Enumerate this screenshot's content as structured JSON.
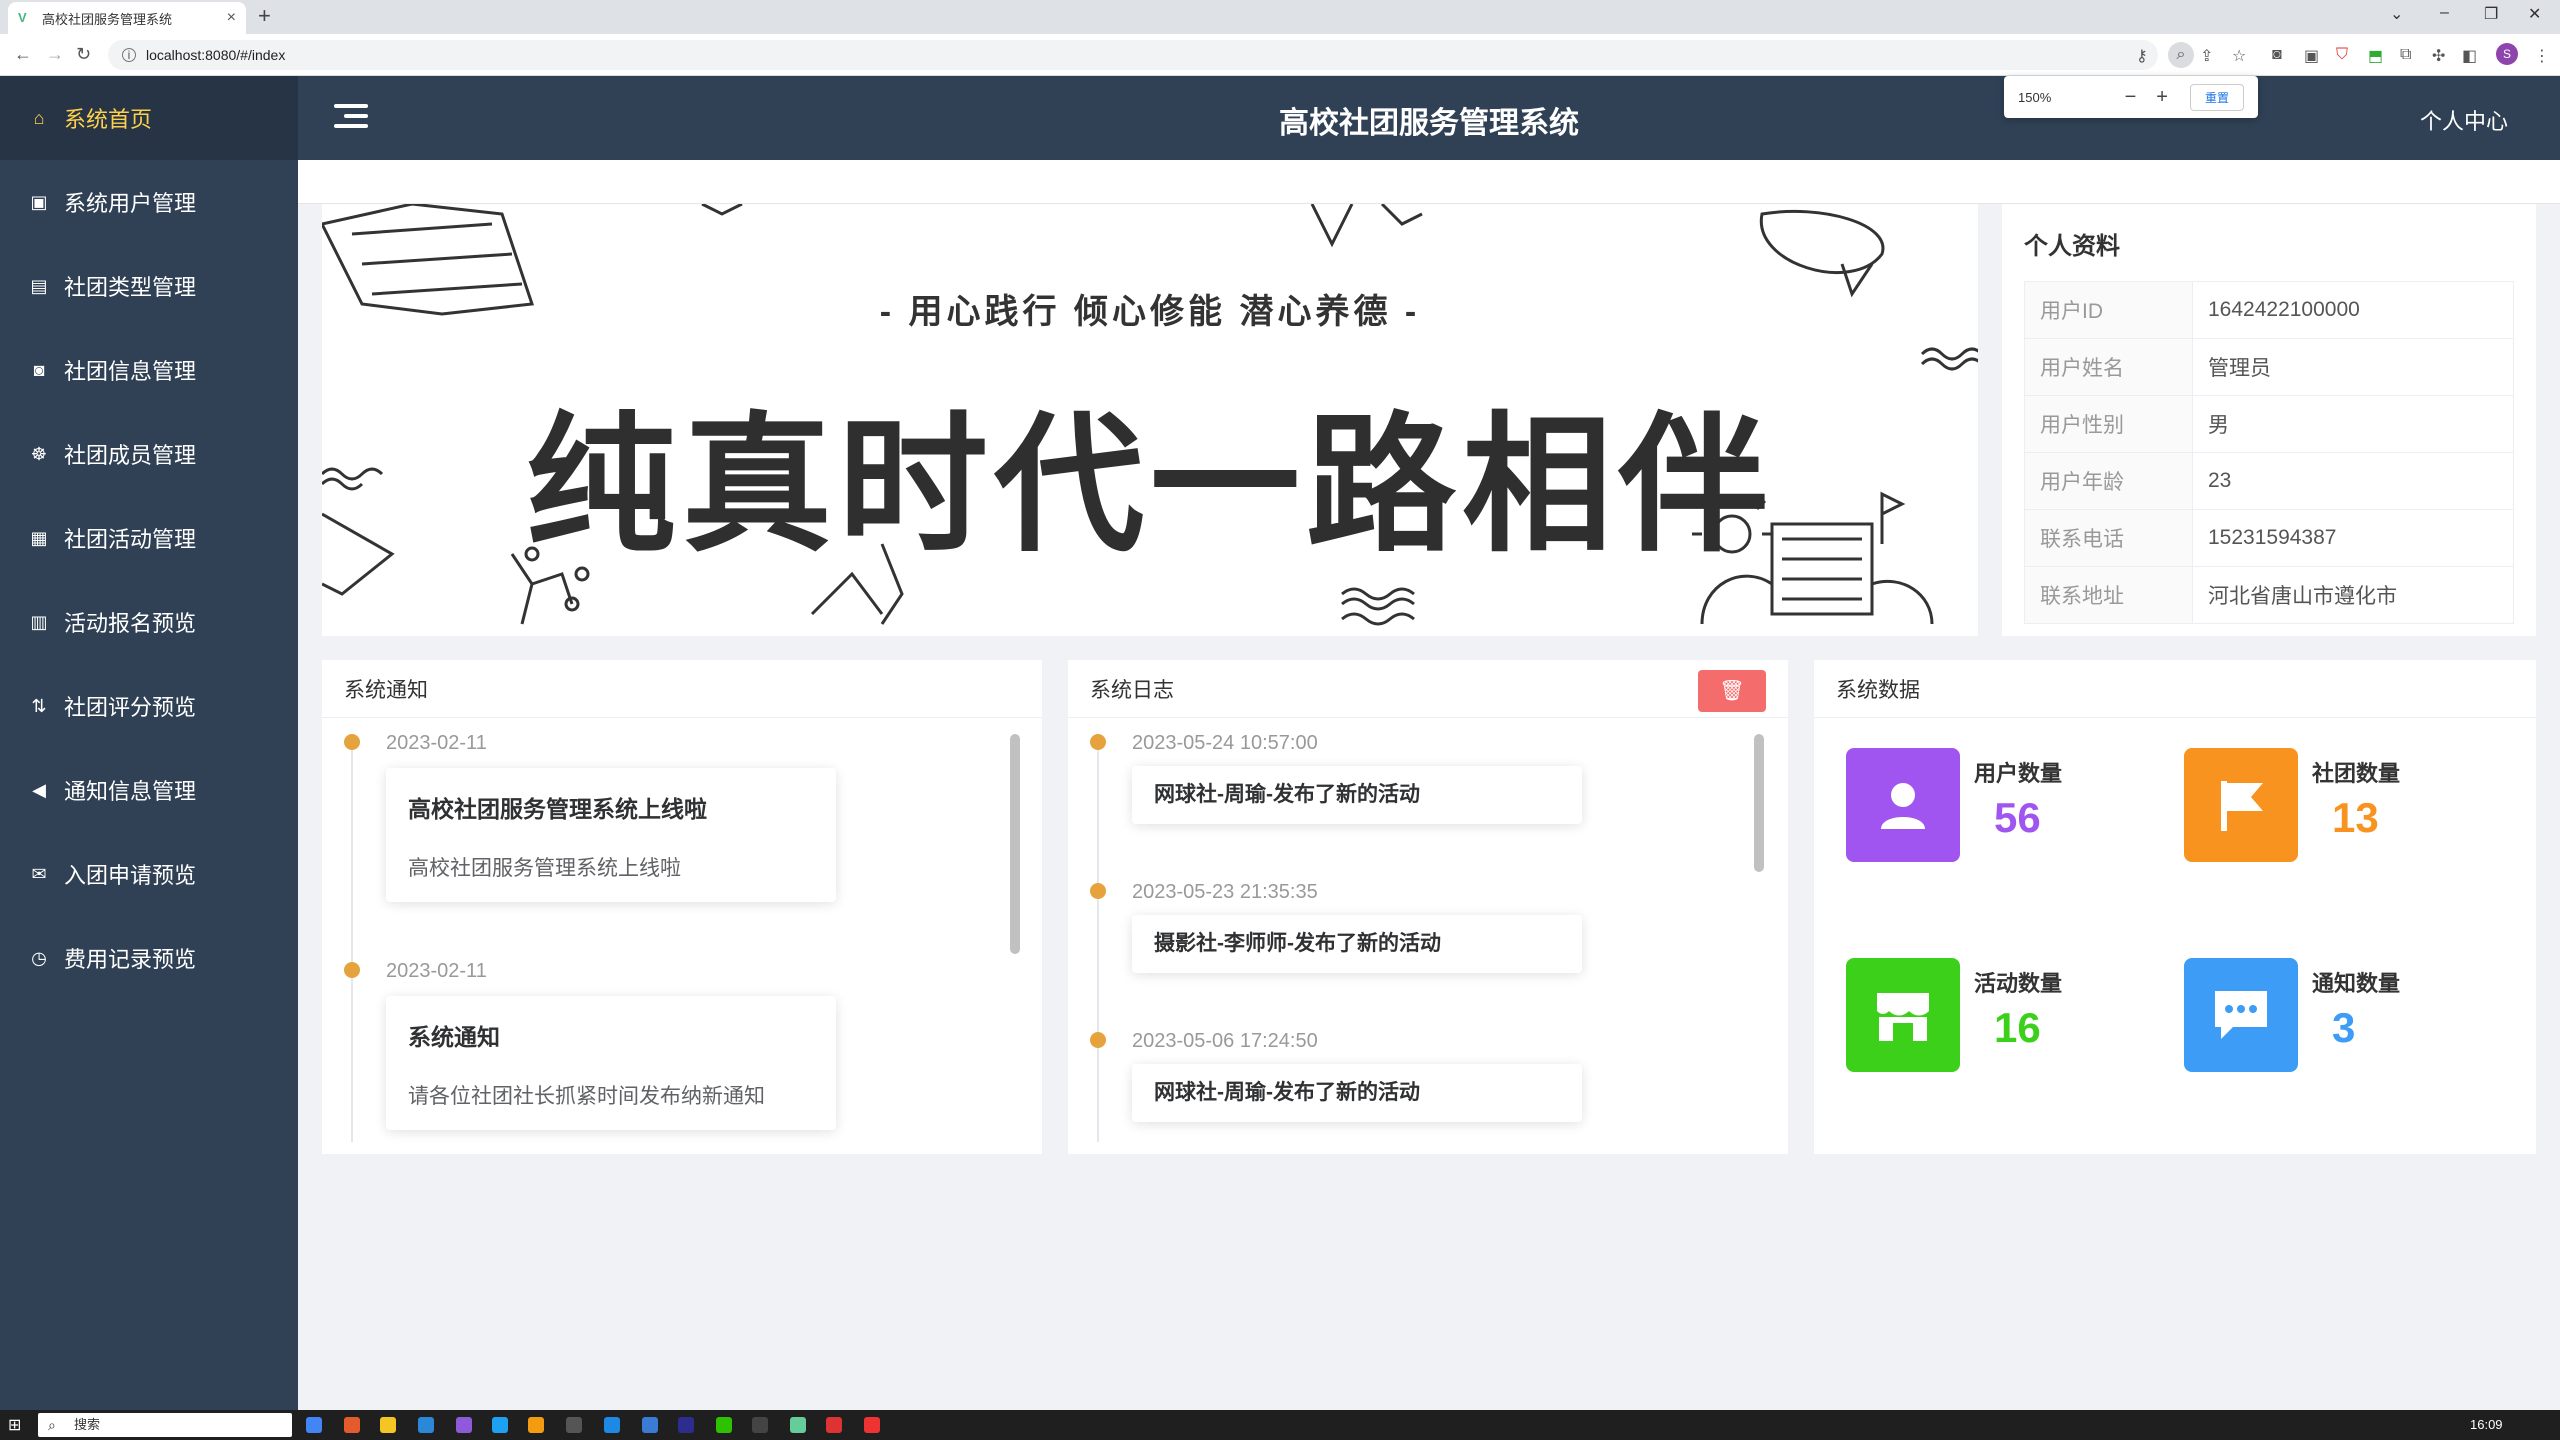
{
  "browser": {
    "tab_title": "高校社团服务管理系统",
    "url": "localhost:8080/#/index",
    "zoom_value": "150%",
    "zoom_reset": "重置",
    "profile_initial": "S"
  },
  "sidebar": {
    "items": [
      {
        "label": "系统首页",
        "icon": "home-icon",
        "active": true
      },
      {
        "label": "系统用户管理",
        "icon": "user-card-icon"
      },
      {
        "label": "社团类型管理",
        "icon": "document-icon"
      },
      {
        "label": "社团信息管理",
        "icon": "bus-icon"
      },
      {
        "label": "社团成员管理",
        "icon": "group-icon"
      },
      {
        "label": "社团活动管理",
        "icon": "calendar-grid-icon"
      },
      {
        "label": "活动报名预览",
        "icon": "calendar-icon"
      },
      {
        "label": "社团评分预览",
        "icon": "sort-icon"
      },
      {
        "label": "通知信息管理",
        "icon": "megaphone-icon"
      },
      {
        "label": "入团申请预览",
        "icon": "mail-open-icon"
      },
      {
        "label": "费用记录预览",
        "icon": "clock-icon"
      }
    ]
  },
  "header": {
    "title": "高校社团服务管理系统",
    "personal_center": "个人中心"
  },
  "banner": {
    "slogan": "- 用心践行  倾心修能  潜心养德 -",
    "headline": "纯真时代一路相伴"
  },
  "profile": {
    "title": "个人资料",
    "rows": [
      {
        "key": "用户ID",
        "value": "1642422100000"
      },
      {
        "key": "用户姓名",
        "value": "管理员"
      },
      {
        "key": "用户性别",
        "value": "男"
      },
      {
        "key": "用户年龄",
        "value": "23"
      },
      {
        "key": "联系电话",
        "value": "15231594387"
      },
      {
        "key": "联系地址",
        "value": "河北省唐山市遵化市"
      }
    ]
  },
  "notices": {
    "title": "系统通知",
    "items": [
      {
        "time": "2023-02-11",
        "title": "高校社团服务管理系统上线啦",
        "content": "高校社团服务管理系统上线啦"
      },
      {
        "time": "2023-02-11",
        "title": "系统通知",
        "content": "请各位社团社长抓紧时间发布纳新通知"
      }
    ]
  },
  "logs": {
    "title": "系统日志",
    "items": [
      {
        "time": "2023-05-24 10:57:00",
        "text": "网球社-周瑜-发布了新的活动"
      },
      {
        "time": "2023-05-23 21:35:35",
        "text": "摄影社-李师师-发布了新的活动"
      },
      {
        "time": "2023-05-06 17:24:50",
        "text": "网球社-周瑜-发布了新的活动"
      }
    ]
  },
  "stats": {
    "title": "系统数据",
    "items": [
      {
        "label": "用户数量",
        "value": "56",
        "color": "#a155f0",
        "icon": "user-icon"
      },
      {
        "label": "社团数量",
        "value": "13",
        "color": "#f7931e",
        "icon": "flag-icon"
      },
      {
        "label": "活动数量",
        "value": "16",
        "color": "#3dd01a",
        "icon": "store-icon"
      },
      {
        "label": "通知数量",
        "value": "3",
        "color": "#3d9cf5",
        "icon": "chat-icon"
      }
    ]
  },
  "taskbar": {
    "search": "搜索",
    "time": "16:09"
  }
}
